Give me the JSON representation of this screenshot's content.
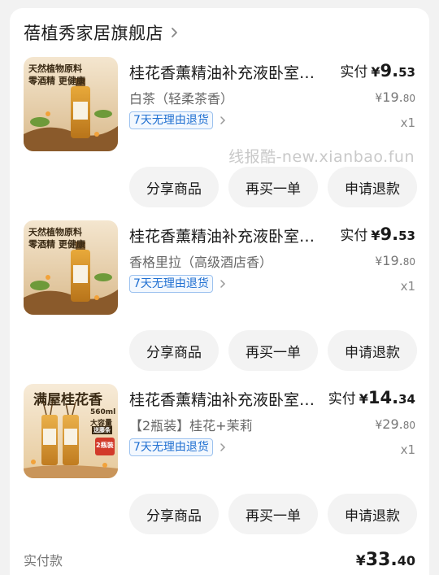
{
  "shop": {
    "name": "蓓植秀家居旗舰店"
  },
  "watermark": "线报酷-new.xianbao.fun",
  "items": [
    {
      "title": "桂花香薰精油补充液卧室…",
      "spec": "白茶（轻柔茶香）",
      "tag": "7天无理由退货",
      "paid_label": "实付",
      "paid_currency": "¥",
      "paid_int": "9.",
      "paid_dec": "53",
      "orig_currency": "¥",
      "orig_int": "19.",
      "orig_dec": "80",
      "qty": "x1",
      "thumb_line1": "天然植物原料",
      "thumb_line2": "零酒精 更健康",
      "buttons": [
        "分享商品",
        "再买一单",
        "申请退款"
      ]
    },
    {
      "title": "桂花香薰精油补充液卧室…",
      "spec": "香格里拉（高级酒店香）",
      "tag": "7天无理由退货",
      "paid_label": "实付",
      "paid_currency": "¥",
      "paid_int": "9.",
      "paid_dec": "53",
      "orig_currency": "¥",
      "orig_int": "19.",
      "orig_dec": "80",
      "qty": "x1",
      "thumb_line1": "天然植物原料",
      "thumb_line2": "零酒精 更健康",
      "buttons": [
        "分享商品",
        "再买一单",
        "申请退款"
      ]
    },
    {
      "title": "桂花香薰精油补充液卧室…",
      "spec": "【2瓶装】桂花+茉莉",
      "tag": "7天无理由退货",
      "paid_label": "实付",
      "paid_currency": "¥",
      "paid_int": "14.",
      "paid_dec": "34",
      "orig_currency": "¥",
      "orig_int": "29.",
      "orig_dec": "80",
      "qty": "x1",
      "thumb_line1": "满屋桂花香",
      "thumb_line2": "560ml",
      "thumb_line3": "大容量",
      "thumb_line4": "送藤条",
      "thumb_badge": "2瓶装",
      "buttons": [
        "分享商品",
        "再买一单",
        "申请退款"
      ]
    }
  ],
  "footer": {
    "label": "实付款",
    "currency": "¥",
    "int": "33.",
    "dec": "40"
  },
  "colors": {
    "tag_blue": "#1f6fd1",
    "button_bg": "#f3f3f3",
    "card_bg": "#ffffff",
    "page_bg": "#f2f2f2"
  }
}
